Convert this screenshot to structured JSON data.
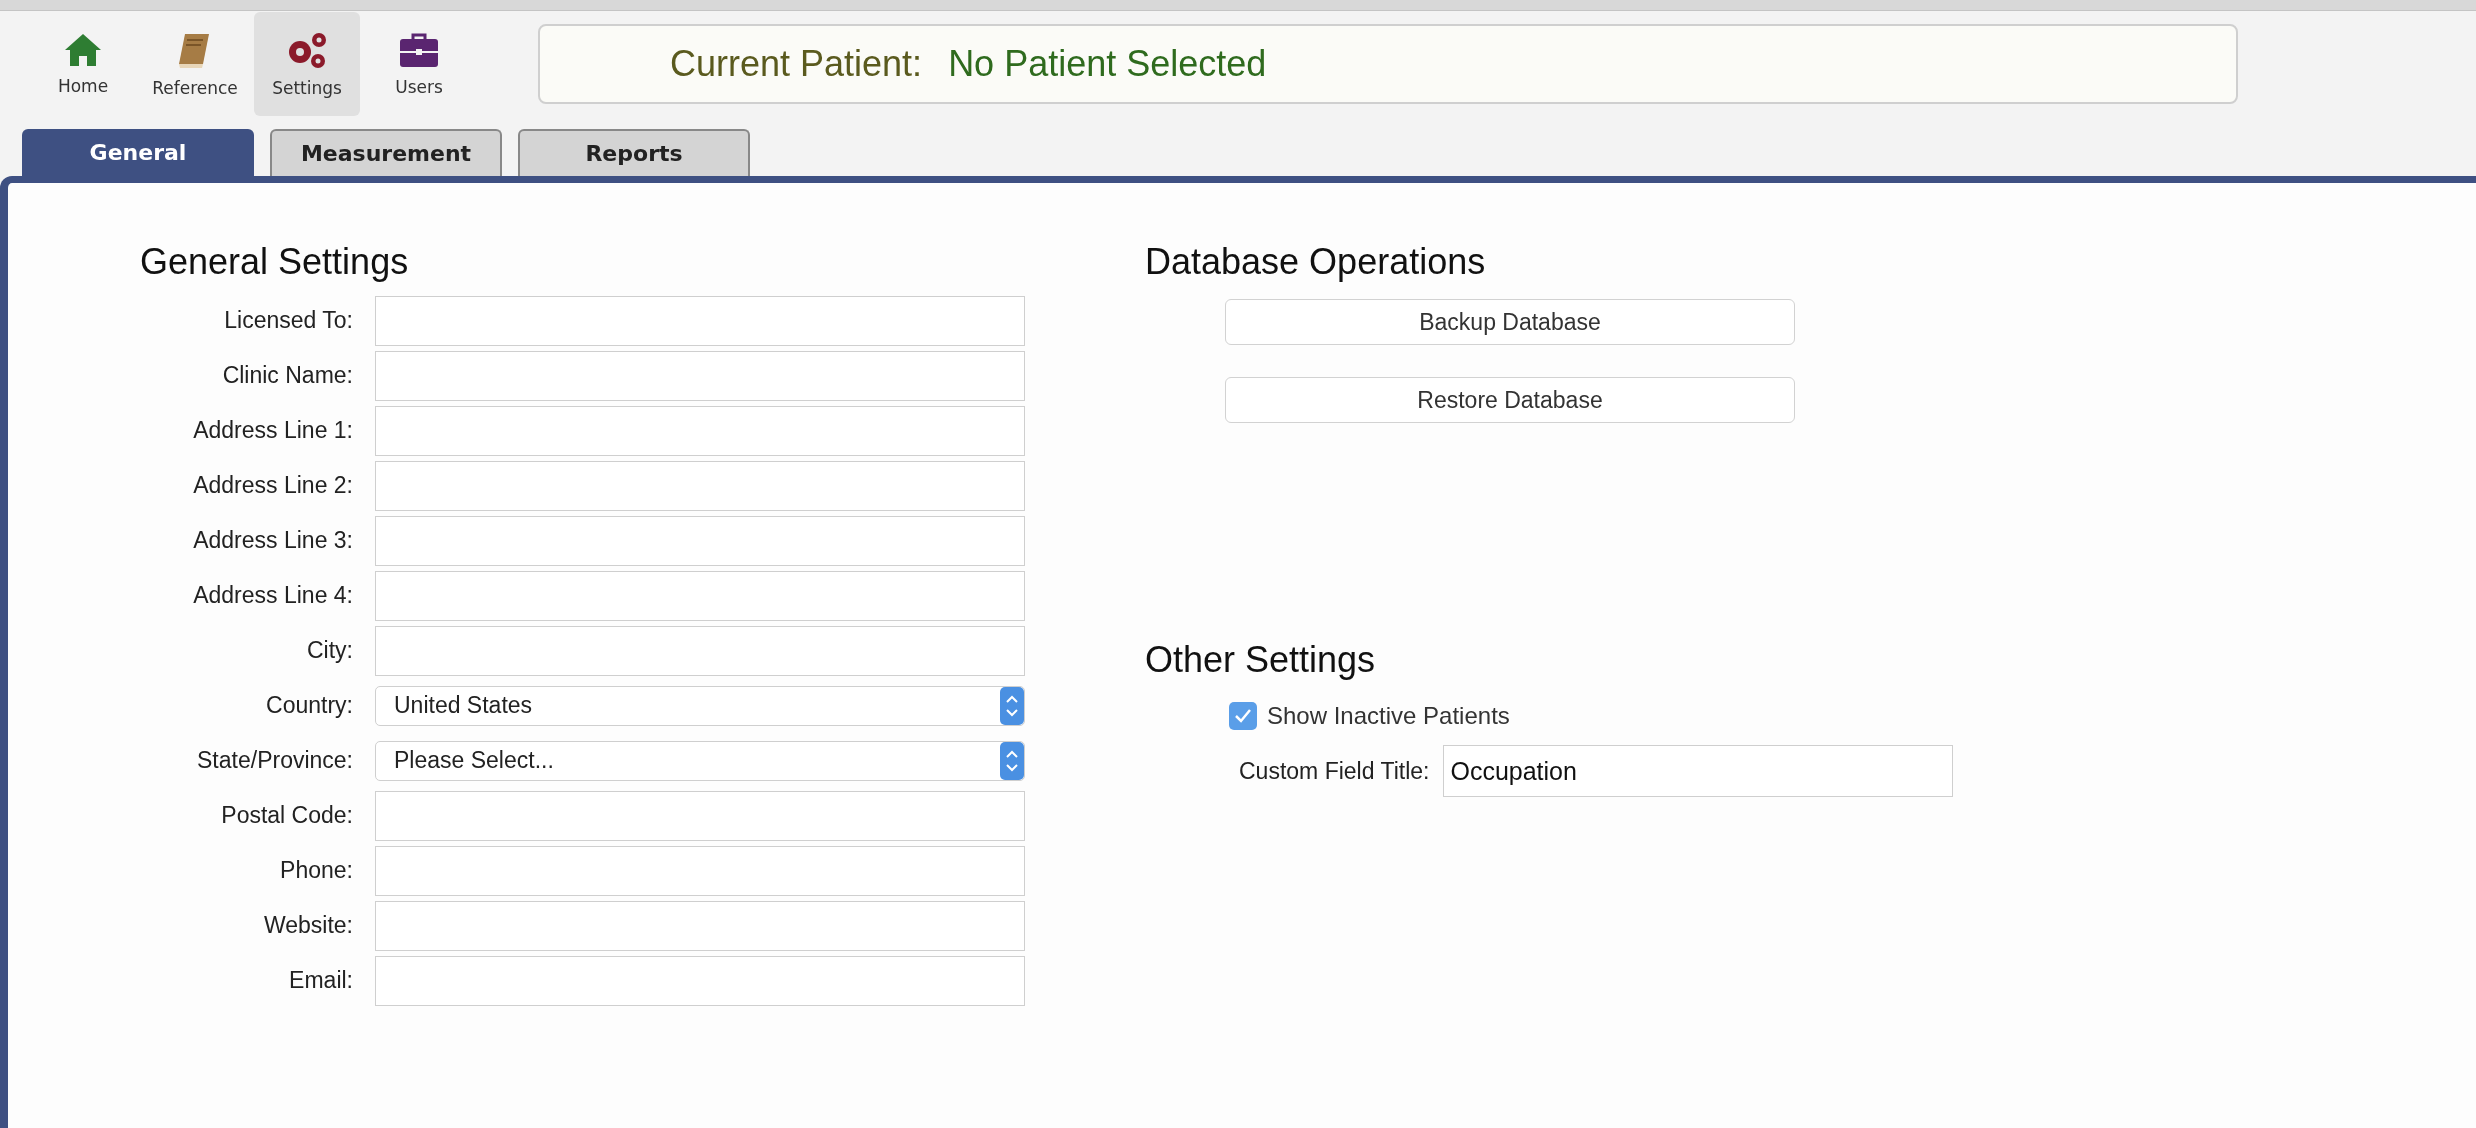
{
  "toolbar": [
    {
      "kind": "home",
      "label": "Home",
      "selected": false
    },
    {
      "kind": "reference",
      "label": "Reference",
      "selected": false
    },
    {
      "kind": "settings",
      "label": "Settings",
      "selected": true
    },
    {
      "kind": "users",
      "label": "Users",
      "selected": false
    }
  ],
  "current_patient": {
    "label": "Current Patient:",
    "value": "No Patient Selected"
  },
  "tabs": [
    {
      "label": "General",
      "selected": true
    },
    {
      "label": "Measurement",
      "selected": false
    },
    {
      "label": "Reports",
      "selected": false
    }
  ],
  "general_settings": {
    "title": "General Settings",
    "fields": [
      {
        "kind": "text",
        "label": "Licensed To:"
      },
      {
        "kind": "text",
        "label": "Clinic Name:"
      },
      {
        "kind": "text",
        "label": "Address Line 1:"
      },
      {
        "kind": "text",
        "label": "Address Line 2:"
      },
      {
        "kind": "text",
        "label": "Address Line 3:"
      },
      {
        "kind": "text",
        "label": "Address Line 4:"
      },
      {
        "kind": "text",
        "label": "City:"
      },
      {
        "kind": "select",
        "label": "Country:",
        "value": "United States"
      },
      {
        "kind": "select",
        "label": "State/Province:",
        "value": "Please Select..."
      },
      {
        "kind": "text",
        "label": "Postal Code:"
      },
      {
        "kind": "text",
        "label": "Phone:"
      },
      {
        "kind": "text",
        "label": "Website:"
      },
      {
        "kind": "text",
        "label": "Email:"
      }
    ]
  },
  "database_operations": {
    "title": "Database Operations",
    "buttons": [
      "Backup Database",
      "Restore Database"
    ]
  },
  "other_settings": {
    "title": "Other Settings",
    "show_inactive": {
      "label": "Show Inactive Patients",
      "checked": true
    },
    "custom_field": {
      "label": "Custom Field Title:",
      "value": "Occupation"
    }
  }
}
